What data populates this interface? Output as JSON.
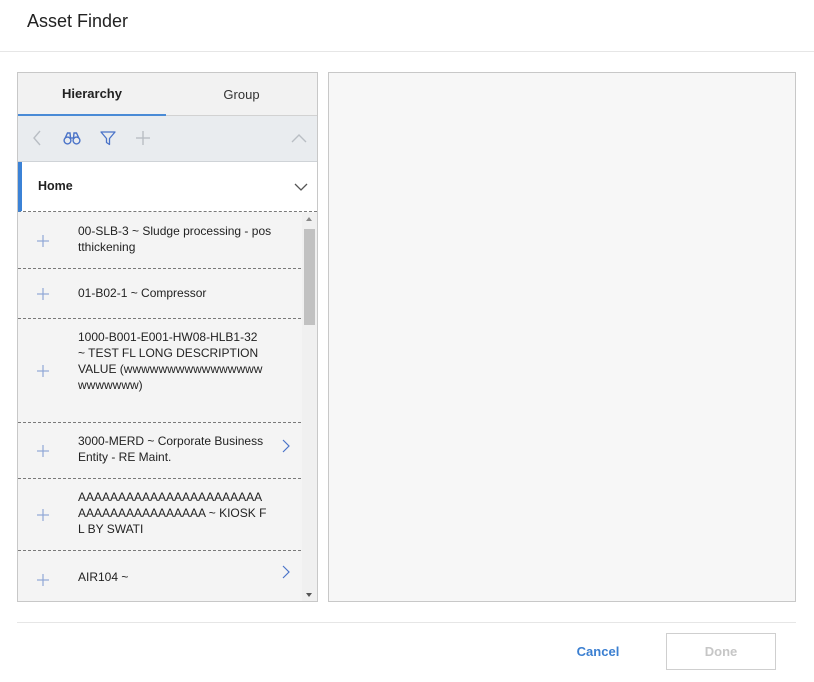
{
  "dialog": {
    "title": "Asset Finder"
  },
  "tabs": [
    {
      "label": "Hierarchy",
      "active": true
    },
    {
      "label": "Group",
      "active": false
    }
  ],
  "toolbar": {
    "icons": [
      "back-chevron-icon",
      "binoculars-icon",
      "filter-icon",
      "add-icon",
      "collapse-chevron-icon"
    ],
    "accent_color": "#4a73c8",
    "disabled_color": "#b9bec4"
  },
  "home": {
    "label": "Home"
  },
  "tree_items": [
    {
      "text": "00-SLB-3 ~ Sludge processing - postthickening",
      "has_children": false
    },
    {
      "text": "01-B02-1 ~ Compressor",
      "has_children": false
    },
    {
      "text": "1000-B001-E001-HW08-HLB1-32 ~ TEST FL LONG DESCRIPTION VALUE (wwwwwwwwwwwwwwwwwwwwwww)",
      "has_children": false
    },
    {
      "text": "3000-MERD ~ Corporate Business Entity - RE Maint.",
      "has_children": true
    },
    {
      "text": "AAAAAAAAAAAAAAAAAAAAAAAAAAAAAAAAAAAAAAA ~ KIOSK FL BY SWATI",
      "has_children": false
    },
    {
      "text": "AIR104 ~",
      "has_children": true
    }
  ],
  "footer": {
    "cancel_label": "Cancel",
    "done_label": "Done"
  },
  "colors": {
    "accent": "#3b82d6",
    "link": "#3b7fd1",
    "disabled_text": "#c6c6c6"
  }
}
